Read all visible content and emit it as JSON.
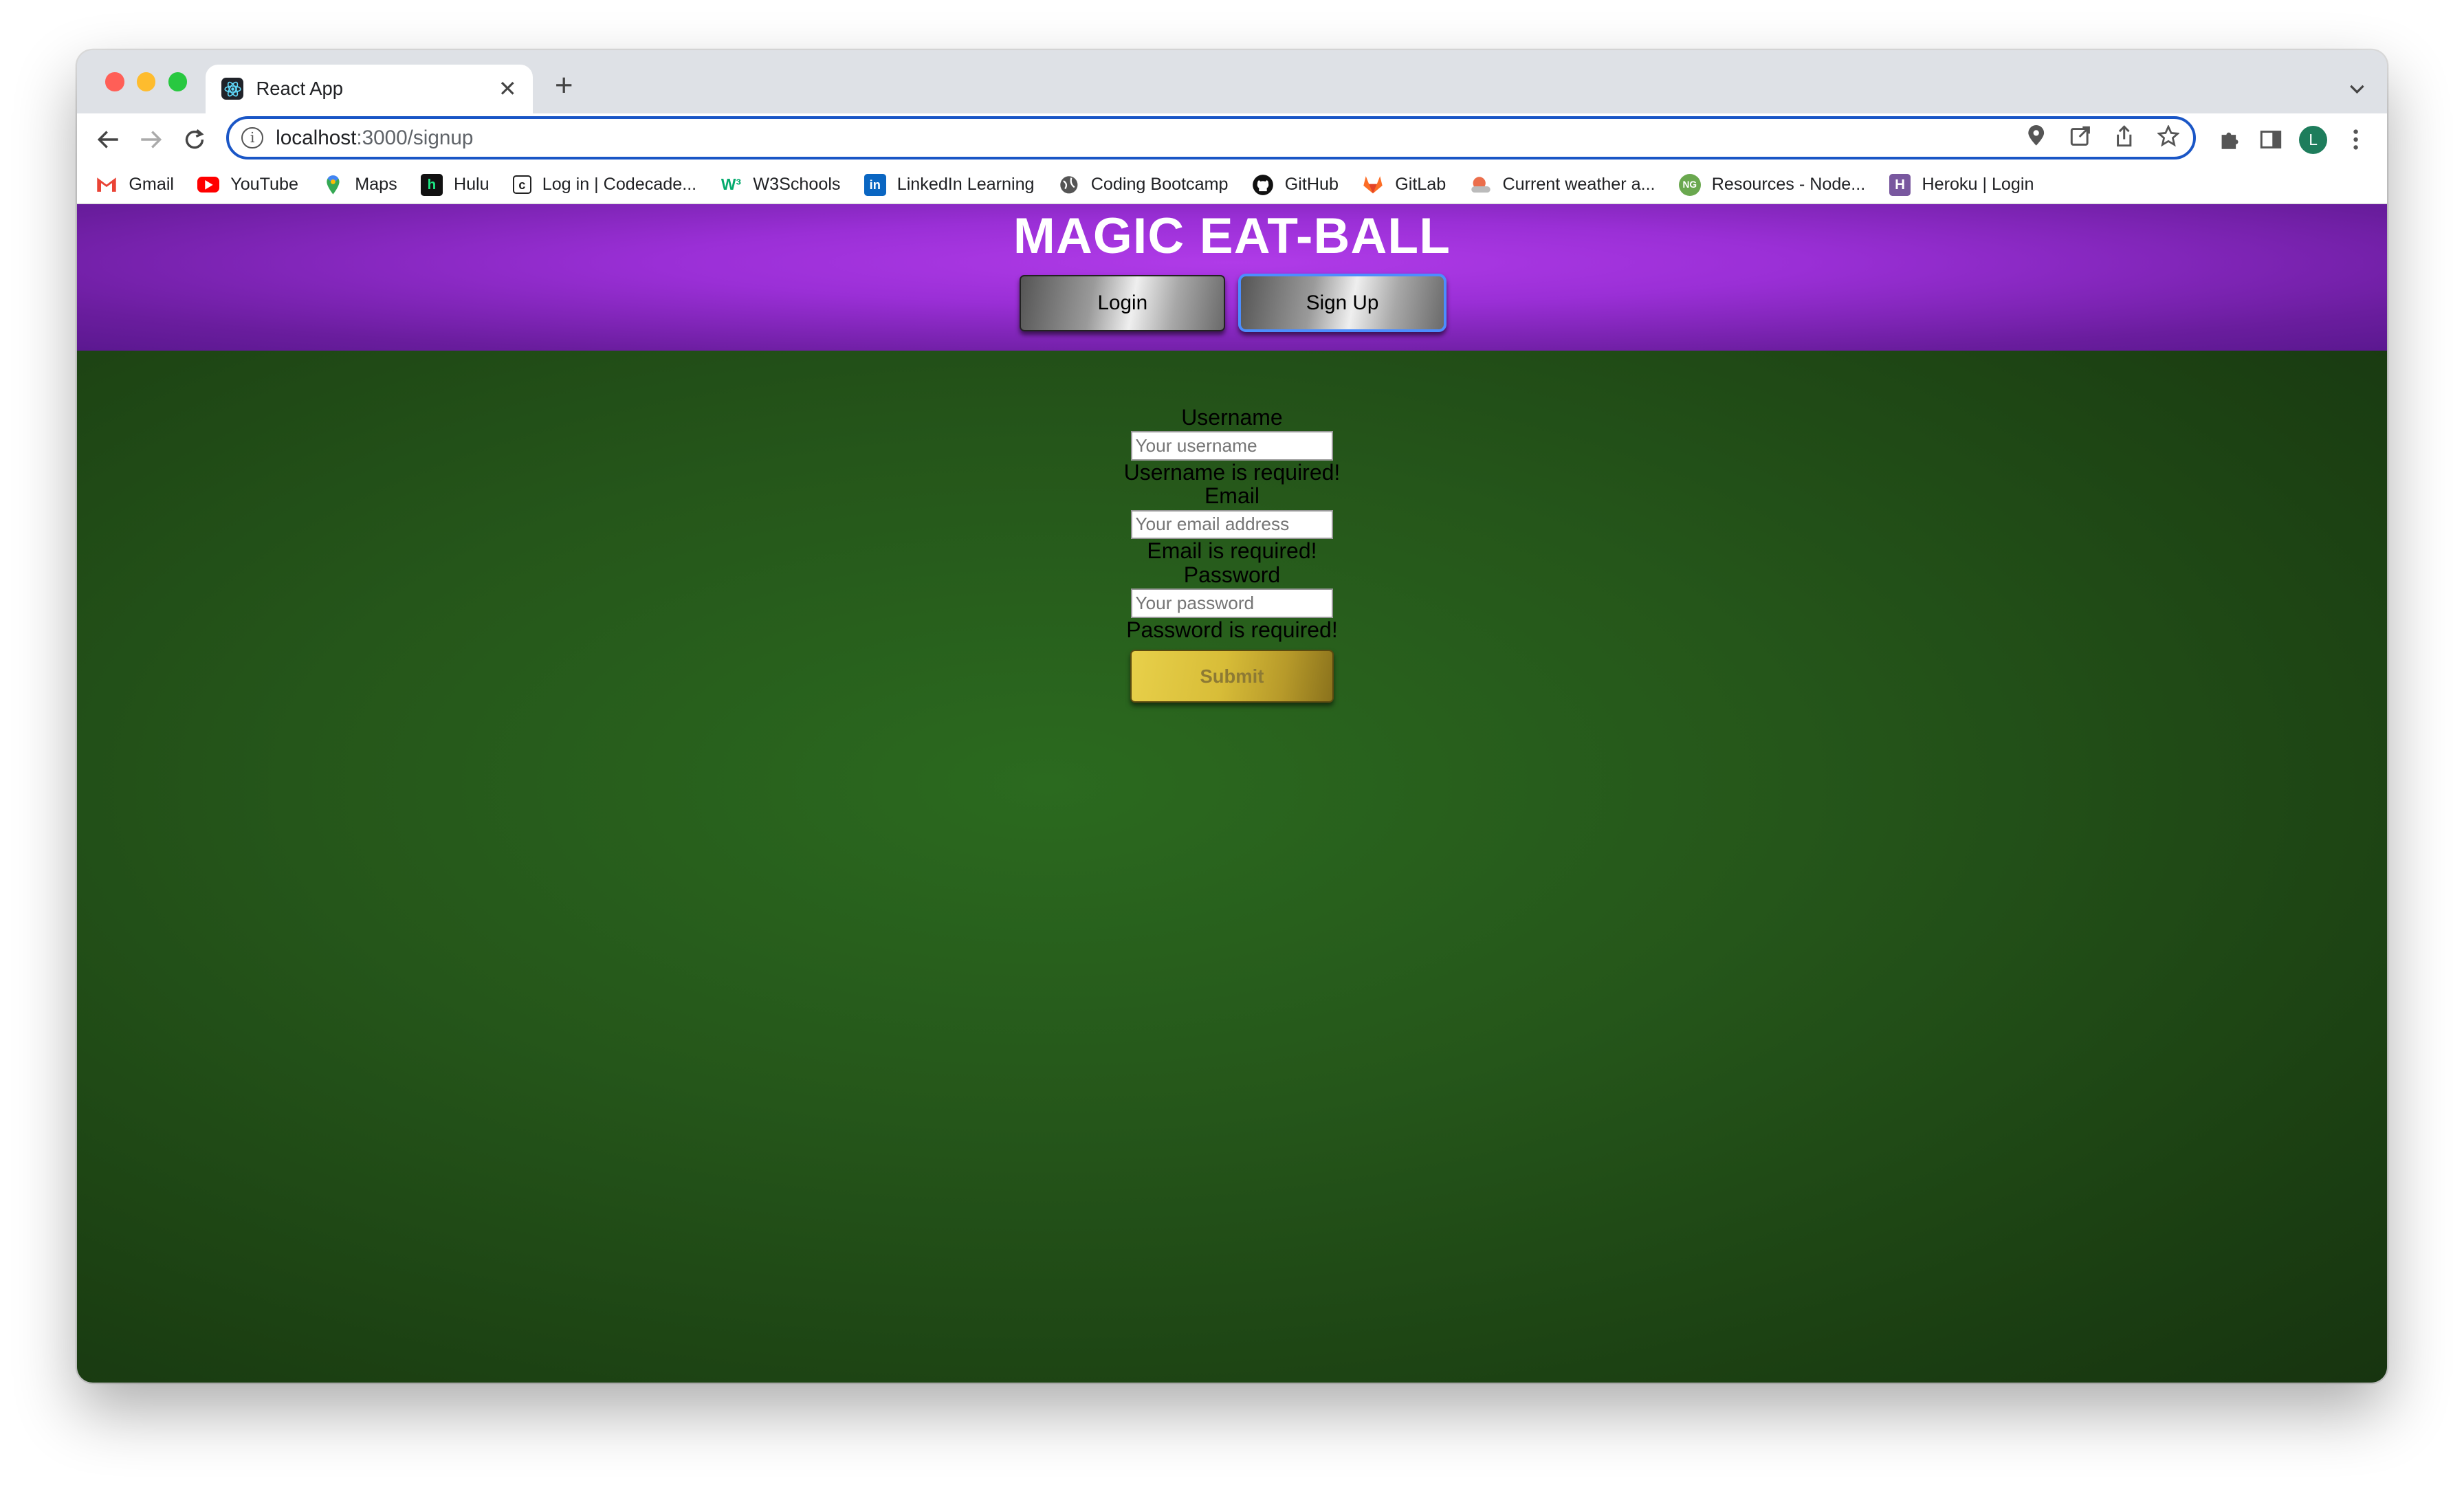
{
  "browser": {
    "tab_title": "React App",
    "new_tab_label": "+",
    "url_host": "localhost",
    "url_path": ":3000/signup",
    "profile_initial": "L",
    "bookmarks": [
      {
        "label": "Gmail"
      },
      {
        "label": "YouTube"
      },
      {
        "label": "Maps"
      },
      {
        "label": "Hulu"
      },
      {
        "label": "Log in | Codecade..."
      },
      {
        "label": "W3Schools"
      },
      {
        "label": "LinkedIn Learning"
      },
      {
        "label": "Coding Bootcamp"
      },
      {
        "label": "GitHub"
      },
      {
        "label": "GitLab"
      },
      {
        "label": "Current weather a..."
      },
      {
        "label": "Resources - Node..."
      },
      {
        "label": "Heroku | Login"
      }
    ]
  },
  "app": {
    "title": "MAGIC EAT-BALL",
    "nav": {
      "login_label": "Login",
      "signup_label": "Sign Up"
    },
    "form": {
      "username_label": "Username",
      "username_placeholder": "Your username",
      "username_error": "Username is required!",
      "email_label": "Email",
      "email_placeholder": "Your email address",
      "email_error": "Email is required!",
      "password_label": "Password",
      "password_placeholder": "Your password",
      "password_error": "Password is required!",
      "submit_label": "Submit"
    }
  },
  "colors": {
    "header_purple": "#9a2fd6",
    "content_green": "#25561a",
    "submit_gold": "#d8bd38"
  }
}
